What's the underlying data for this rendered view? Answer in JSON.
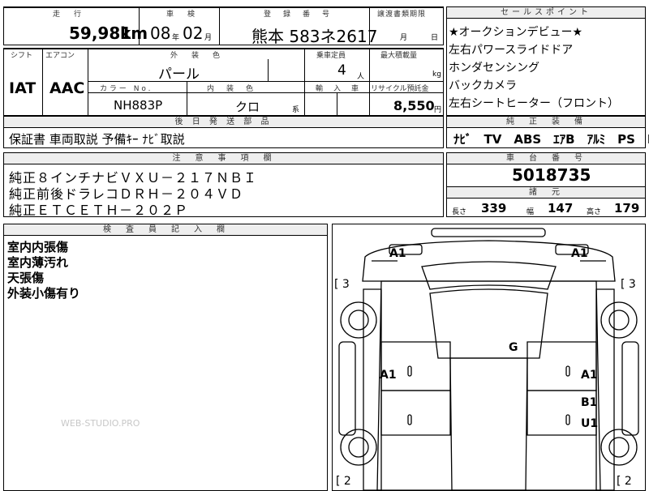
{
  "mileage": {
    "header": "走　行",
    "value": "59,981",
    "unit": "km"
  },
  "inspection": {
    "header": "車　検",
    "year": "08",
    "year_unit": "年",
    "month": "02",
    "month_unit": "月"
  },
  "registration": {
    "header": "登　録　番　号",
    "value": "熊本 583ネ2617"
  },
  "transfer": {
    "header": "譲渡書類期限",
    "month_unit": "月",
    "day_unit": "日"
  },
  "shift": {
    "header": "シフト",
    "value": "IAT"
  },
  "aircon": {
    "header": "エアコン",
    "value": "AAC"
  },
  "exterior_color": {
    "header": "外　装　色",
    "value": "パール"
  },
  "capacity": {
    "header": "乗車定員",
    "value": "4",
    "unit": "人"
  },
  "max_load": {
    "header": "最大積載量",
    "unit": "kg"
  },
  "color_no": {
    "header": "カ ラ ー　N o .",
    "value": "NH883P"
  },
  "interior_color": {
    "header": "内　装　色",
    "value": "クロ",
    "suffix": "系"
  },
  "import_car": {
    "header": "輸　入　車"
  },
  "recycle": {
    "header": "リサイクル預託金",
    "value": "8,550",
    "unit": "円"
  },
  "sales_points": {
    "header": "セールスポイント",
    "items": [
      "★オークションデビュー★",
      "左右パワースライドドア",
      "ホンダセンシング",
      "バックカメラ",
      "左右シートヒーター（フロント）"
    ]
  },
  "later_parts": {
    "header": "後 日 発 送 部 品",
    "value": "保証書 車両取説 予備ｷｰ ﾅﾋﾞ取説"
  },
  "genuine_equipment": {
    "header": "純　正　装　備",
    "value": "ﾅﾋﾞ　TV　ABS　ｴｱB　ｱﾙﾐ　PS　PW"
  },
  "notes": {
    "header": "注　意　事　項　欄",
    "lines": [
      "純正８インチナビＶＸＵ－２１７ＮＢＩ",
      "純正前後ドラレコＤＲＨ－２０４ＶＤ",
      "純正ＥＴＣＥＴＨ－２０２Ｐ"
    ]
  },
  "chassis": {
    "header": "車　台　番　号",
    "value": "5018735"
  },
  "specs": {
    "header": "諸　元",
    "length_label": "長さ",
    "length": "339",
    "width_label": "幅",
    "width": "147",
    "height_label": "高さ",
    "height": "179"
  },
  "inspector": {
    "header": "検　査　員　記　入　欄",
    "lines": [
      "室内内張傷",
      "室内薄汚れ",
      "天張傷",
      "外装小傷有り"
    ],
    "watermark": "WEB-STUDIO.PRO"
  },
  "diagram": {
    "marks": {
      "front_left": "A1",
      "front_right": "A1",
      "left_bracket": "[ 3",
      "right_bracket": "[ 3",
      "roof": "G",
      "left_door": "A1",
      "right_front_door": "A1",
      "right_rear_door_1": "B1",
      "right_rear_door_2": "U1",
      "bottom_left": "[ 2",
      "bottom_right": "[ 2"
    }
  }
}
